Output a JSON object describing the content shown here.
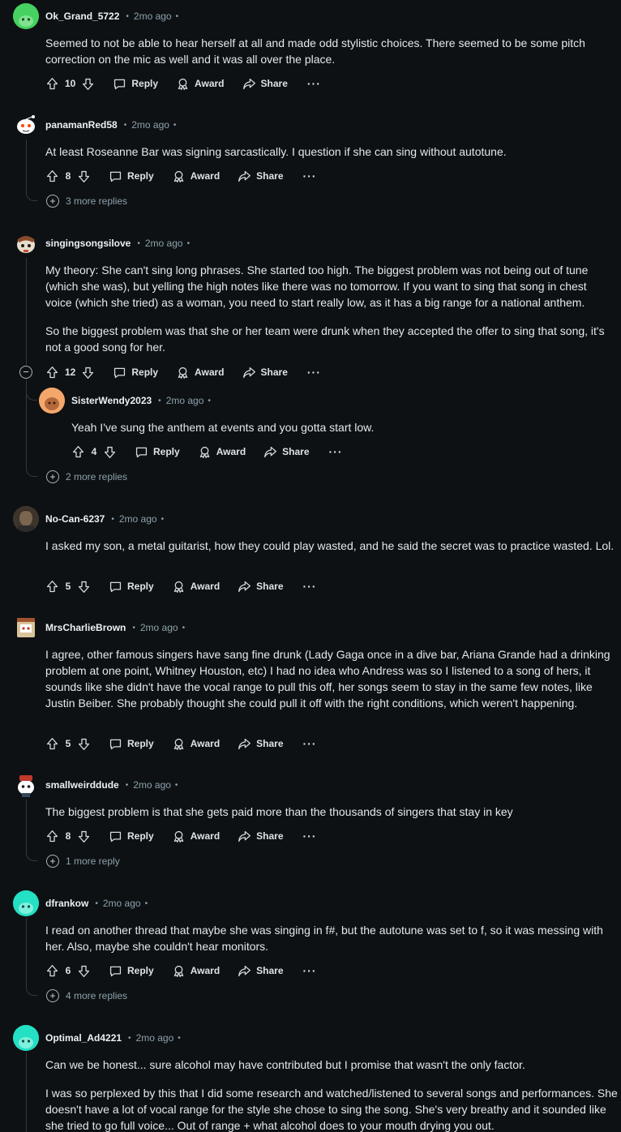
{
  "actions": {
    "reply": "Reply",
    "award": "Award",
    "share": "Share",
    "more": "···"
  },
  "comments": [
    {
      "author": "Ok_Grand_5722",
      "time": "2mo ago",
      "votes": "10",
      "avatar_color": "#46d160",
      "avatar": "snoo-green-avatar",
      "paragraphs": [
        "Seemed to not be able to hear herself at all and made odd stylistic choices. There seemed to be some pitch correction on the mic as well and it was all over the place."
      ]
    },
    {
      "author": "panamanRed58",
      "time": "2mo ago",
      "votes": "8",
      "avatar_color": "#ffffff",
      "avatar": "snoo-white-avatar",
      "paragraphs": [
        "At least Roseanne Bar was signing sarcastically. I question if she can sing without autotune."
      ],
      "more_replies": "3 more replies"
    },
    {
      "author": "singingsongsilove",
      "time": "2mo ago",
      "votes": "12",
      "avatar_color": "#8a5a3c",
      "avatar": "snoo-costume-avatar",
      "paragraphs": [
        "My theory: She can't sing long phrases. She started too high. The biggest problem was not being out of tune (which she was), but yelling the high notes like there was no tomorrow. If you want to sing that song in chest voice (which she tried) as a woman, you need to start really low, as it has a big range for a national anthem.",
        "So the biggest problem was that she or her team were drunk when they accepted the offer to sing that song, it's not a good song for her."
      ],
      "more_replies": "2 more replies"
    },
    {
      "author": "SisterWendy2023",
      "time": "2mo ago",
      "votes": "4",
      "avatar_color": "#f4a76b",
      "avatar": "snoo-orange-avatar",
      "paragraphs": [
        "Yeah I've sung the anthem at events and you gotta start low."
      ]
    },
    {
      "author": "No-Can-6237",
      "time": "2mo ago",
      "votes": "5",
      "avatar_color": "#5a4a3a",
      "avatar": "photo-avatar",
      "paragraphs": [
        "I asked my son, a metal guitarist, how they could play wasted, and he said the secret was to practice wasted. Lol."
      ]
    },
    {
      "author": "MrsCharlieBrown",
      "time": "2mo ago",
      "votes": "5",
      "avatar_color": "#d9c49a",
      "avatar": "snoo-box-avatar",
      "paragraphs": [
        "I agree, other famous singers have sang fine drunk (Lady Gaga once in a dive bar, Ariana Grande had a drinking problem at one point, Whitney Houston, etc) I had no idea who Andress was so I listened to a song of hers, it sounds like she didn't have the vocal range to pull this off, her songs seem to stay in the same few notes, like Justin Beiber. She probably thought she could pull it off with the right conditions, which weren't happening."
      ]
    },
    {
      "author": "smallweirddude",
      "time": "2mo ago",
      "votes": "8",
      "avatar_color": "#ffffff",
      "avatar": "snoo-hat-avatar",
      "paragraphs": [
        "The biggest problem is that she gets paid more than the thousands of singers that stay in key"
      ],
      "more_replies": "1 more reply"
    },
    {
      "author": "dfrankow",
      "time": "2mo ago",
      "votes": "6",
      "avatar_color": "#24e0c4",
      "avatar": "snoo-teal-avatar",
      "paragraphs": [
        "I read on another thread that maybe she was singing in f#, but the autotune was set to f, so it was messing with her. Also, maybe she couldn't hear monitors."
      ],
      "more_replies": "4 more replies"
    },
    {
      "author": "Optimal_Ad4221",
      "time": "2mo ago",
      "avatar_color": "#24e0c4",
      "avatar": "snoo-teal-avatar",
      "paragraphs": [
        "Can we be honest... sure alcohol may have contributed but I promise that wasn't the only factor.",
        "I was so perplexed by this that I did some research and watched/listened to several songs and performances. She doesn't have a lot of vocal range for the style she chose to sing the song. She's very breathy and it sounded like she tried to go full voice... Out of range + what alcohol does to your mouth drying you out."
      ]
    }
  ]
}
